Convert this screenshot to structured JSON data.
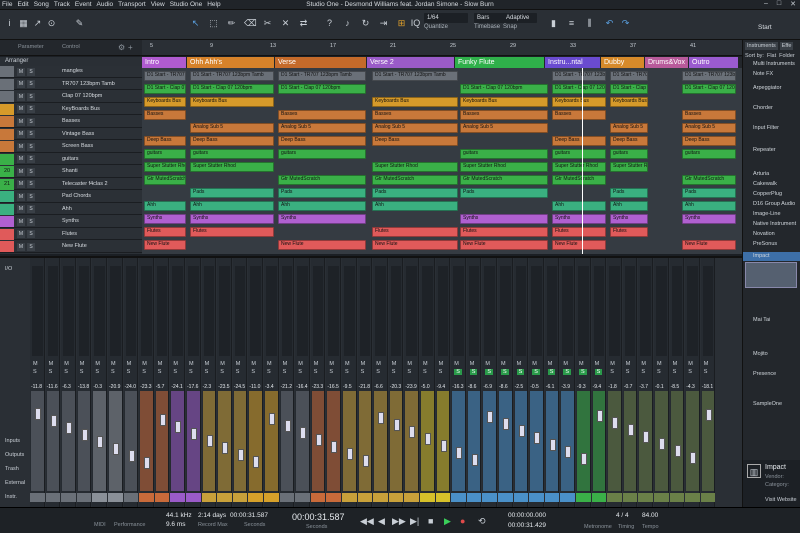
{
  "window": {
    "title": "Studio One - Desmond Williams feat. Jordan Simone - Slow Burn"
  },
  "menu": [
    "File",
    "Edit",
    "Song",
    "Track",
    "Event",
    "Audio",
    "Transport",
    "View",
    "Studio One",
    "Help"
  ],
  "toolbar": {
    "quantize": {
      "value": "1/64",
      "label": "Quantize"
    },
    "timebase": {
      "value": "Bars",
      "label": "Timebase"
    },
    "snap": {
      "value": "Adaptive",
      "label": "Snap"
    },
    "start_label": "Start",
    "inspector_labels": [
      "Parameter",
      "Control"
    ]
  },
  "arranger": {
    "label": "Arranger"
  },
  "ruler": [
    "5",
    "9",
    "13",
    "17",
    "21",
    "25",
    "29",
    "33",
    "37",
    "41"
  ],
  "markers": [
    {
      "label": "Intro",
      "color": "#b05bd0"
    },
    {
      "label": "Ohh Ahh's",
      "color": "#d6822a"
    },
    {
      "label": "Verse",
      "color": "#c46a2a"
    },
    {
      "label": "Verse 2",
      "color": "#9a5bc8"
    },
    {
      "label": "Funky Flute",
      "color": "#2fb04a"
    },
    {
      "label": "Instru...ntal",
      "color": "#6a4bd0"
    },
    {
      "label": "Dubby",
      "color": "#d68a2a"
    },
    {
      "label": "Drums&Vox",
      "color": "#b85a9a"
    },
    {
      "label": "Outro",
      "color": "#9a5bd0"
    }
  ],
  "tracks": [
    {
      "num": "",
      "name": "mangles",
      "color": "#6a7078"
    },
    {
      "num": "",
      "name": "TR707 123bpm Tamb",
      "color": "#6a7078"
    },
    {
      "num": "",
      "name": "Clap 07 120bpm",
      "color": "#6a7078"
    },
    {
      "num": "",
      "name": "KeyBoards Bus",
      "color": "#d69a2a"
    },
    {
      "num": "",
      "name": "Basses",
      "color": "#c8783a"
    },
    {
      "num": "",
      "name": "Vintage Bass",
      "color": "#c8783a"
    },
    {
      "num": "",
      "name": "Screen Bass",
      "color": "#c8783a"
    },
    {
      "num": "",
      "name": "guitars",
      "color": "#3ab048"
    },
    {
      "num": "20",
      "name": "Shanti",
      "color": "#3ab048"
    },
    {
      "num": "21",
      "name": "Telecaster f4clas 2",
      "color": "#3ab048"
    },
    {
      "num": "",
      "name": "Pad Chords",
      "color": "#3ab080"
    },
    {
      "num": "",
      "name": "Ahh",
      "color": "#3ab080"
    },
    {
      "num": "",
      "name": "Synths",
      "color": "#b060d0"
    },
    {
      "num": "",
      "name": "Flutes",
      "color": "#e05a5a"
    },
    {
      "num": "",
      "name": "New Flute",
      "color": "#e05a5a"
    }
  ],
  "clip_rows": [
    {
      "label": "D1 Start - TR707 123bpm Tamb",
      "color": "#6a7078"
    },
    {
      "label": "D1 Start - Clap 07 120bpm",
      "color": "#3ab048"
    },
    {
      "label": "Keyboards Bus",
      "color": "#d69a2a"
    },
    {
      "label": "Basses",
      "color": "#c8783a"
    },
    {
      "label": "Analog Sub 5",
      "color": "#c8783a"
    },
    {
      "label": "Deep Bass",
      "color": "#c8783a"
    },
    {
      "label": "guitars",
      "color": "#3ab048"
    },
    {
      "label": "Super Stutter Rhod",
      "color": "#3ab048"
    },
    {
      "label": "Gtr MutedScratch",
      "color": "#3ab048"
    },
    {
      "label": "Pads",
      "color": "#3ab080"
    },
    {
      "label": "Ahh",
      "color": "#3ab080"
    },
    {
      "label": "Synths",
      "color": "#b060d0"
    },
    {
      "label": "Flutes",
      "color": "#e05a5a"
    },
    {
      "label": "New Flute",
      "color": "#e05a5a"
    }
  ],
  "mixer": {
    "side_labels": [
      "I/O",
      "Inputs",
      "Outputs",
      "Trash",
      "External",
      "Instr."
    ],
    "db_values": [
      "-11.8",
      "-11.6",
      "-6.3",
      "-13.8",
      "-0.3",
      "-20.9",
      "-24.0",
      "-23.3",
      "-5.7",
      "-24.1",
      "-17.6",
      "-2.3",
      "-23.5",
      "-24.5",
      "-11.0",
      "-3.4",
      "-21.2",
      "-16.4",
      "-23.3",
      "-16.5",
      "-9.5",
      "-21.8",
      "-6.6",
      "-20.3",
      "-23.9",
      "-5.0",
      "-9.4",
      "-16.3",
      "-8.6",
      "-6.9",
      "-8.6",
      "-2.5",
      "-0.5",
      "-6.1",
      "-3.9",
      "-9.3",
      "-9.4",
      "-1.8",
      "-0.7",
      "-3.7",
      "-0.1",
      "-8.5",
      "-4.3",
      "-18.1"
    ],
    "strip_colors": [
      "#6a7078",
      "#6a7078",
      "#6a7078",
      "#6a7078",
      "#8a9098",
      "#8a9098",
      "#6a7078",
      "#c86a3a",
      "#c86a3a",
      "#9a5bc8",
      "#9a5bc8",
      "#c8a03a",
      "#c8a03a",
      "#c8a03a",
      "#d6a02a",
      "#d6a02a",
      "#6a7078",
      "#6a7078",
      "#c86a3a",
      "#c86a3a",
      "#c8a03a",
      "#c8a03a",
      "#c8a03a",
      "#c8a03a",
      "#c8a03a",
      "#d6c02a",
      "#d6c02a",
      "#4a90c8",
      "#4a90c8",
      "#4a90c8",
      "#4a90c8",
      "#4a90c8",
      "#4a90c8",
      "#4a90c8",
      "#4a90c8",
      "#3ab048",
      "#3ab048",
      "#6a8048",
      "#6a8048",
      "#6a8048",
      "#6a8048",
      "#6a8048",
      "#6a8048",
      "#6a8048"
    ],
    "solo_label": "S",
    "mute_label": "M"
  },
  "browser": {
    "tabs": [
      "Instruments",
      "Effe"
    ],
    "sort_label": "Sort by:",
    "sort_options": [
      "Flat",
      "Folder"
    ],
    "items": [
      "Multi Instruments",
      "Note FX",
      "Arpeggiator",
      "Chorder",
      "Input Filter",
      "Repeater",
      "Arturia",
      "Cakewalk",
      "CopperPlug",
      "D16 Group Audio",
      "Image-Line",
      "Native Instrument",
      "Novation",
      "PreSonus",
      "Impact",
      "Mai Tai",
      "Mojito",
      "Presence",
      "SampleOne"
    ],
    "footer": {
      "name": "Impact",
      "vendor": "Vendor:",
      "category": "Category:",
      "website": "Visit Website"
    }
  },
  "transport": {
    "midi_label": "MIDI",
    "performance_label": "Performance",
    "sample_rate": "44.1 kHz",
    "latency": "9.6 ms",
    "record_time": "2:14 days",
    "record_max_label": "Record Max",
    "position_small": "00:00:31.587",
    "seconds_label": "Seconds",
    "position_main": "00:00:31.587",
    "seconds_label2": "Seconds",
    "left_locator": "00:00:00.000",
    "right_locator": "00:00:31.429",
    "metronome_label": "Metronome",
    "time_sig": "4 / 4",
    "timing_label": "Timing",
    "tempo": "84.00",
    "tempo_label": "Tempo"
  }
}
